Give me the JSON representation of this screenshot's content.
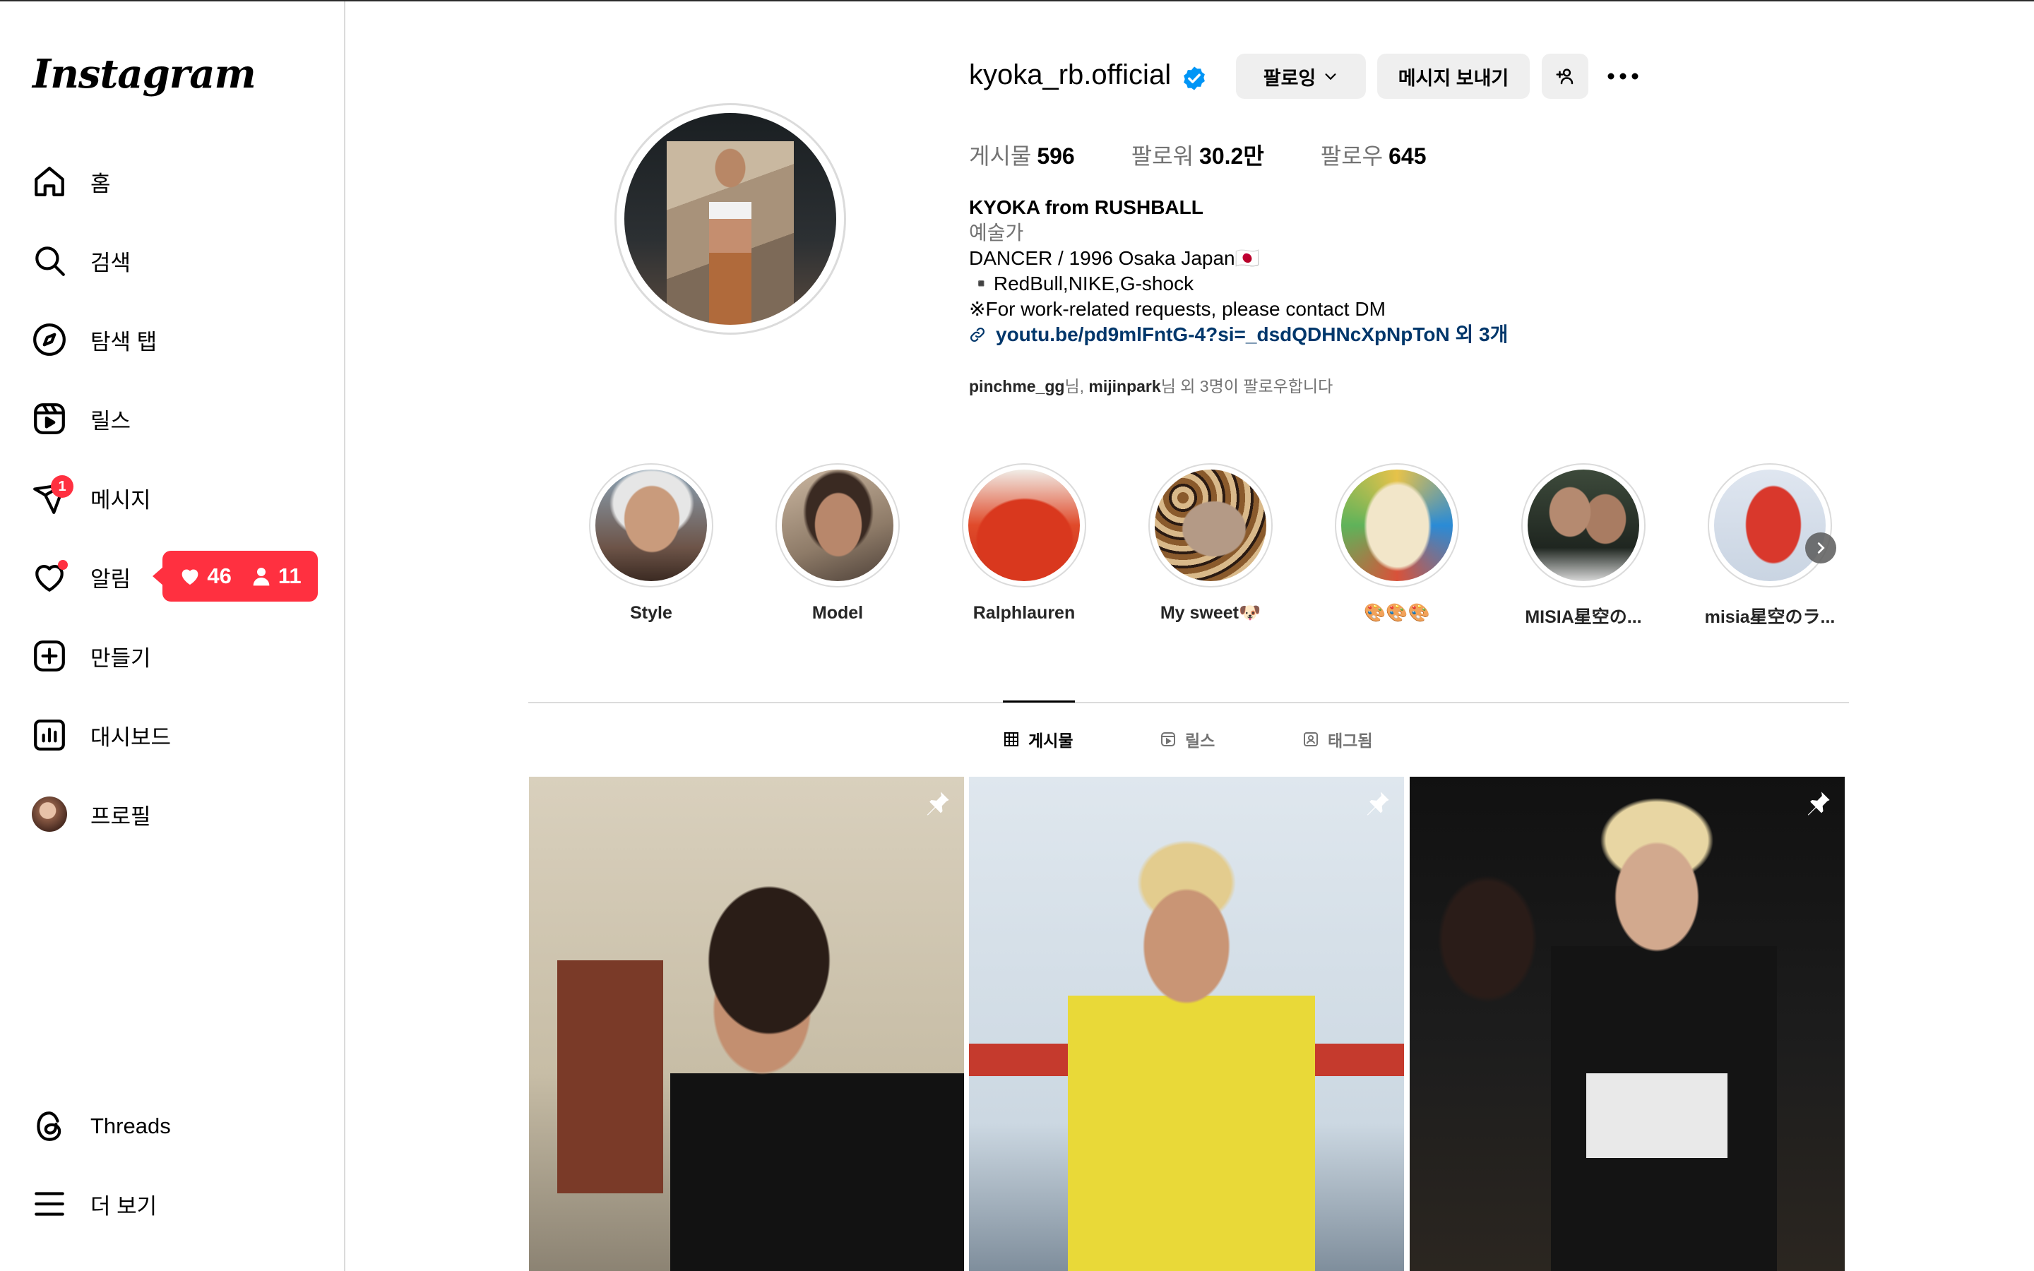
{
  "app": {
    "logo_text": "Instagram"
  },
  "sidebar": {
    "items": [
      {
        "label": "홈",
        "icon": "home-icon"
      },
      {
        "label": "검색",
        "icon": "search-icon"
      },
      {
        "label": "탐색 탭",
        "icon": "compass-icon"
      },
      {
        "label": "릴스",
        "icon": "reels-icon"
      },
      {
        "label": "메시지",
        "icon": "messenger-icon",
        "badge": "1"
      },
      {
        "label": "알림",
        "icon": "heart-icon"
      },
      {
        "label": "만들기",
        "icon": "plus-square-icon"
      },
      {
        "label": "대시보드",
        "icon": "dashboard-icon"
      },
      {
        "label": "프로필",
        "icon": "avatar"
      }
    ],
    "threads_label": "Threads",
    "more_label": "더 보기",
    "notification_popup": {
      "likes": "46",
      "follows": "11"
    }
  },
  "profile": {
    "username": "kyoka_rb.official",
    "verified": true,
    "following_button": "팔로잉",
    "message_button": "메시지 보내기",
    "stats": [
      {
        "label": "게시물",
        "value": "596"
      },
      {
        "label": "팔로워",
        "value": "30.2만"
      },
      {
        "label": "팔로우",
        "value": "645"
      }
    ],
    "bio": {
      "name": "KYOKA from RUSHBALL",
      "category": "예술가",
      "line1": "DANCER / 1996 Osaka Japan🇯🇵",
      "line2": "▪️RedBull,NIKE,G-shock",
      "line3": "※For work-related requests, please contact DM",
      "link": "youtu.be/pd9mlFntG-4?si=_dsdQDHNcXpNpToN 외 3개"
    },
    "followed_by": {
      "user1": "pinchme_gg",
      "suffix1": "님, ",
      "user2": "mijinpark",
      "suffix2": "님 외 3명이 팔로우합니다"
    }
  },
  "highlights": [
    {
      "label": "Style"
    },
    {
      "label": "Model"
    },
    {
      "label": "Ralphlauren"
    },
    {
      "label": "My sweet🐶"
    },
    {
      "label": "🎨🎨🎨"
    },
    {
      "label": "MISIA星空の..."
    },
    {
      "label": "misia星空のラ..."
    }
  ],
  "tabs": [
    {
      "label": "게시물",
      "icon": "grid-icon",
      "active": true
    },
    {
      "label": "릴스",
      "icon": "reels-icon",
      "active": false
    },
    {
      "label": "태그됨",
      "icon": "tagged-icon",
      "active": false
    }
  ],
  "colors": {
    "accent_red": "#ff3040",
    "link_blue": "#00376b",
    "verified_blue": "#0095f6"
  }
}
